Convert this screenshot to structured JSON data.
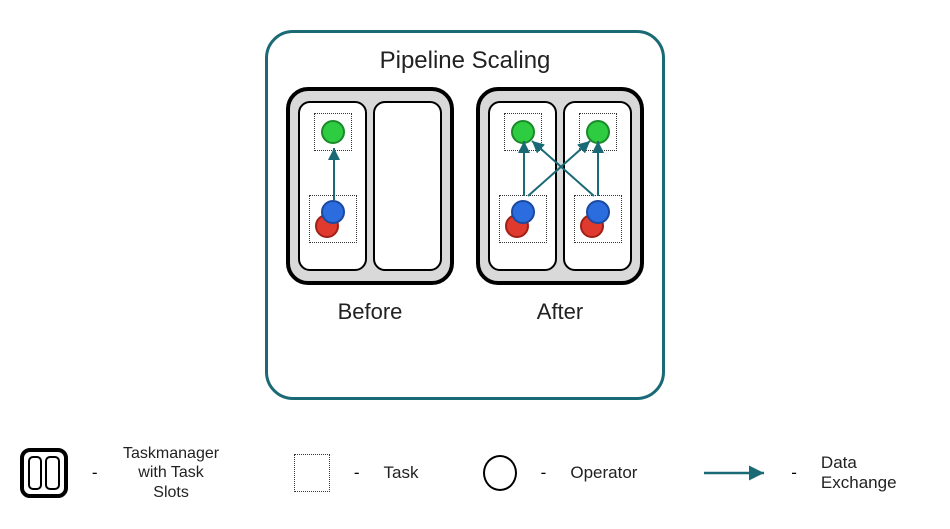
{
  "diagram": {
    "title": "Pipeline Scaling",
    "stages": {
      "before": {
        "label": "Before",
        "slots": [
          {
            "occupied": true,
            "arrows_to": [
              "self"
            ]
          },
          {
            "occupied": false
          }
        ]
      },
      "after": {
        "label": "After",
        "slots": [
          {
            "occupied": true,
            "arrows_to": [
              "self",
              "other"
            ]
          },
          {
            "occupied": true,
            "arrows_to": [
              "self",
              "other"
            ]
          }
        ]
      }
    },
    "operator_colors": {
      "top": "#2ecc40",
      "middle": "#2b6cdf",
      "bottom": "#e03a2e"
    }
  },
  "legend": {
    "items": [
      {
        "key": "taskmanager",
        "label_line1": "Taskmanager",
        "label_line2": "with Task Slots"
      },
      {
        "key": "task",
        "label": "Task"
      },
      {
        "key": "operator",
        "label": "Operator"
      },
      {
        "key": "data_exchange",
        "label": "Data Exchange"
      }
    ]
  }
}
